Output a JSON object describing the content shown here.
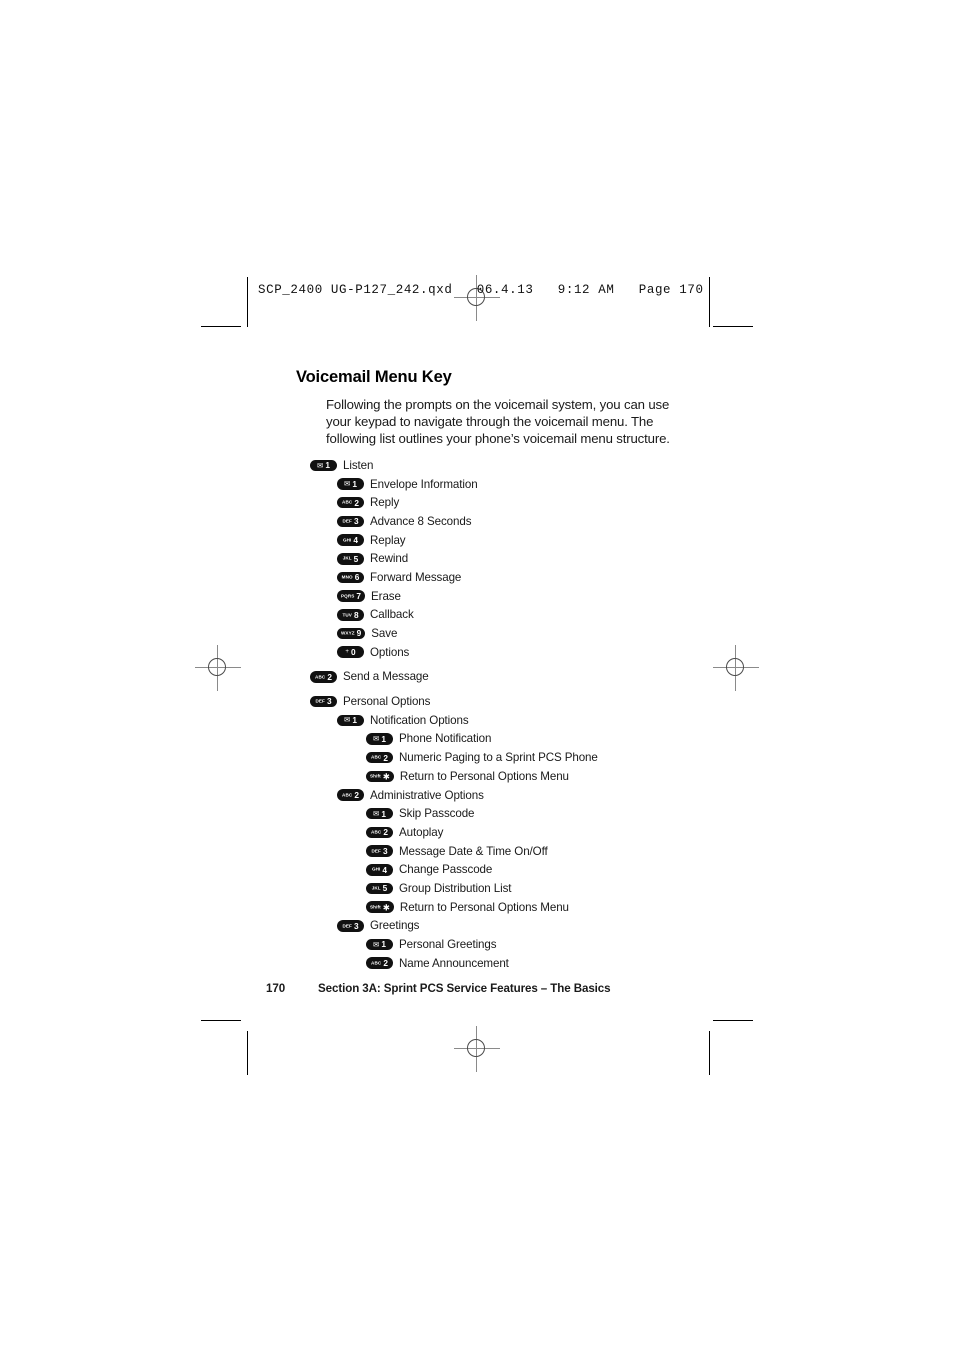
{
  "prepress": {
    "file_header": "SCP_2400 UG-P127_242.qxd   06.4.13   9:12 AM   Page 170"
  },
  "page": {
    "title": "Voicemail Menu Key",
    "intro": "Following the prompts on the voicemail system, you can use your keypad to navigate through the voicemail menu. The following list outlines your phone’s voicemail menu structure.",
    "footer": {
      "page_number": "170",
      "section": "Section 3A: Sprint PCS Service Features – The Basics"
    }
  },
  "menu": {
    "items": [
      {
        "level": 1,
        "key": {
          "alpha": "",
          "digit": "1",
          "glyph": "envelope"
        },
        "label": "Listen",
        "gap": false
      },
      {
        "level": 2,
        "key": {
          "alpha": "",
          "digit": "1",
          "glyph": "envelope"
        },
        "label": "Envelope Information",
        "gap": false
      },
      {
        "level": 2,
        "key": {
          "alpha": "ABC",
          "digit": "2",
          "glyph": ""
        },
        "label": "Reply",
        "gap": false
      },
      {
        "level": 2,
        "key": {
          "alpha": "DEF",
          "digit": "3",
          "glyph": ""
        },
        "label": "Advance 8 Seconds",
        "gap": false
      },
      {
        "level": 2,
        "key": {
          "alpha": "GHI",
          "digit": "4",
          "glyph": ""
        },
        "label": "Replay",
        "gap": false
      },
      {
        "level": 2,
        "key": {
          "alpha": "JKL",
          "digit": "5",
          "glyph": ""
        },
        "label": "Rewind",
        "gap": false
      },
      {
        "level": 2,
        "key": {
          "alpha": "MNO",
          "digit": "6",
          "glyph": ""
        },
        "label": "Forward Message",
        "gap": false
      },
      {
        "level": 2,
        "key": {
          "alpha": "PQRS",
          "digit": "7",
          "glyph": ""
        },
        "label": "Erase",
        "gap": false
      },
      {
        "level": 2,
        "key": {
          "alpha": "TUV",
          "digit": "8",
          "glyph": ""
        },
        "label": "Callback",
        "gap": false
      },
      {
        "level": 2,
        "key": {
          "alpha": "WXYZ",
          "digit": "9",
          "glyph": ""
        },
        "label": "Save",
        "gap": false
      },
      {
        "level": 2,
        "key": {
          "alpha": "",
          "digit": "0",
          "glyph": "plus"
        },
        "label": "Options",
        "gap": false
      },
      {
        "level": 1,
        "key": {
          "alpha": "ABC",
          "digit": "2",
          "glyph": ""
        },
        "label": "Send a Message",
        "gap": true
      },
      {
        "level": 1,
        "key": {
          "alpha": "DEF",
          "digit": "3",
          "glyph": ""
        },
        "label": "Personal Options",
        "gap": true
      },
      {
        "level": 2,
        "key": {
          "alpha": "",
          "digit": "1",
          "glyph": "envelope"
        },
        "label": "Notification Options",
        "gap": false
      },
      {
        "level": 3,
        "key": {
          "alpha": "",
          "digit": "1",
          "glyph": "envelope"
        },
        "label": "Phone Notification",
        "gap": false
      },
      {
        "level": 3,
        "key": {
          "alpha": "ABC",
          "digit": "2",
          "glyph": ""
        },
        "label": "Numeric Paging to a Sprint PCS Phone",
        "gap": false
      },
      {
        "level": 3,
        "key": {
          "alpha": "Shift",
          "digit": "",
          "glyph": "star"
        },
        "label": "Return to Personal Options Menu",
        "gap": false
      },
      {
        "level": 2,
        "key": {
          "alpha": "ABC",
          "digit": "2",
          "glyph": ""
        },
        "label": "Administrative Options",
        "gap": false
      },
      {
        "level": 3,
        "key": {
          "alpha": "",
          "digit": "1",
          "glyph": "envelope"
        },
        "label": "Skip Passcode",
        "gap": false
      },
      {
        "level": 3,
        "key": {
          "alpha": "ABC",
          "digit": "2",
          "glyph": ""
        },
        "label": "Autoplay",
        "gap": false
      },
      {
        "level": 3,
        "key": {
          "alpha": "DEF",
          "digit": "3",
          "glyph": ""
        },
        "label": "Message Date & Time On/Off",
        "gap": false
      },
      {
        "level": 3,
        "key": {
          "alpha": "GHI",
          "digit": "4",
          "glyph": ""
        },
        "label": "Change Passcode",
        "gap": false
      },
      {
        "level": 3,
        "key": {
          "alpha": "JKL",
          "digit": "5",
          "glyph": ""
        },
        "label": "Group Distribution List",
        "gap": false
      },
      {
        "level": 3,
        "key": {
          "alpha": "Shift",
          "digit": "",
          "glyph": "star"
        },
        "label": "Return to Personal Options Menu",
        "gap": false
      },
      {
        "level": 2,
        "key": {
          "alpha": "DEF",
          "digit": "3",
          "glyph": ""
        },
        "label": "Greetings",
        "gap": false
      },
      {
        "level": 3,
        "key": {
          "alpha": "",
          "digit": "1",
          "glyph": "envelope"
        },
        "label": "Personal Greetings",
        "gap": false
      },
      {
        "level": 3,
        "key": {
          "alpha": "ABC",
          "digit": "2",
          "glyph": ""
        },
        "label": "Name Announcement",
        "gap": false
      }
    ]
  }
}
